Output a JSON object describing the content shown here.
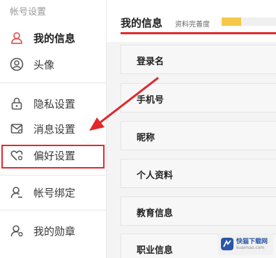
{
  "sidebar": {
    "section_title": "帐号设置",
    "items": [
      {
        "label": "我的信息",
        "icon": "user-icon",
        "active": true
      },
      {
        "label": "头像",
        "icon": "avatar-icon",
        "active": false
      },
      {
        "label": "隐私设置",
        "icon": "lock-icon",
        "active": false
      },
      {
        "label": "消息设置",
        "icon": "message-icon",
        "active": false
      },
      {
        "label": "偏好设置",
        "icon": "heart-gear-icon",
        "active": false
      },
      {
        "label": "帐号绑定",
        "icon": "user-link-icon",
        "active": false
      },
      {
        "label": "我的勋章",
        "icon": "medal-user-icon",
        "active": false
      }
    ]
  },
  "main": {
    "title": "我的信息",
    "completeness_label": "资料完善度",
    "completeness_fraction": 0.35,
    "rows": [
      {
        "label": "登录名"
      },
      {
        "label": "手机号"
      },
      {
        "label": "昵称"
      },
      {
        "label": "个人资料"
      },
      {
        "label": "教育信息"
      },
      {
        "label": "职业信息"
      }
    ]
  },
  "annotation": {
    "highlight_color": "#e0282c",
    "arrow_color": "#e0282c"
  },
  "watermark": {
    "text": "快猫下载网",
    "sub": "kuaimao.com"
  },
  "colors": {
    "accent": "#e02a2a",
    "progress": "#f5c84a",
    "icon_active": "#e05a5a",
    "icon": "#555555"
  }
}
